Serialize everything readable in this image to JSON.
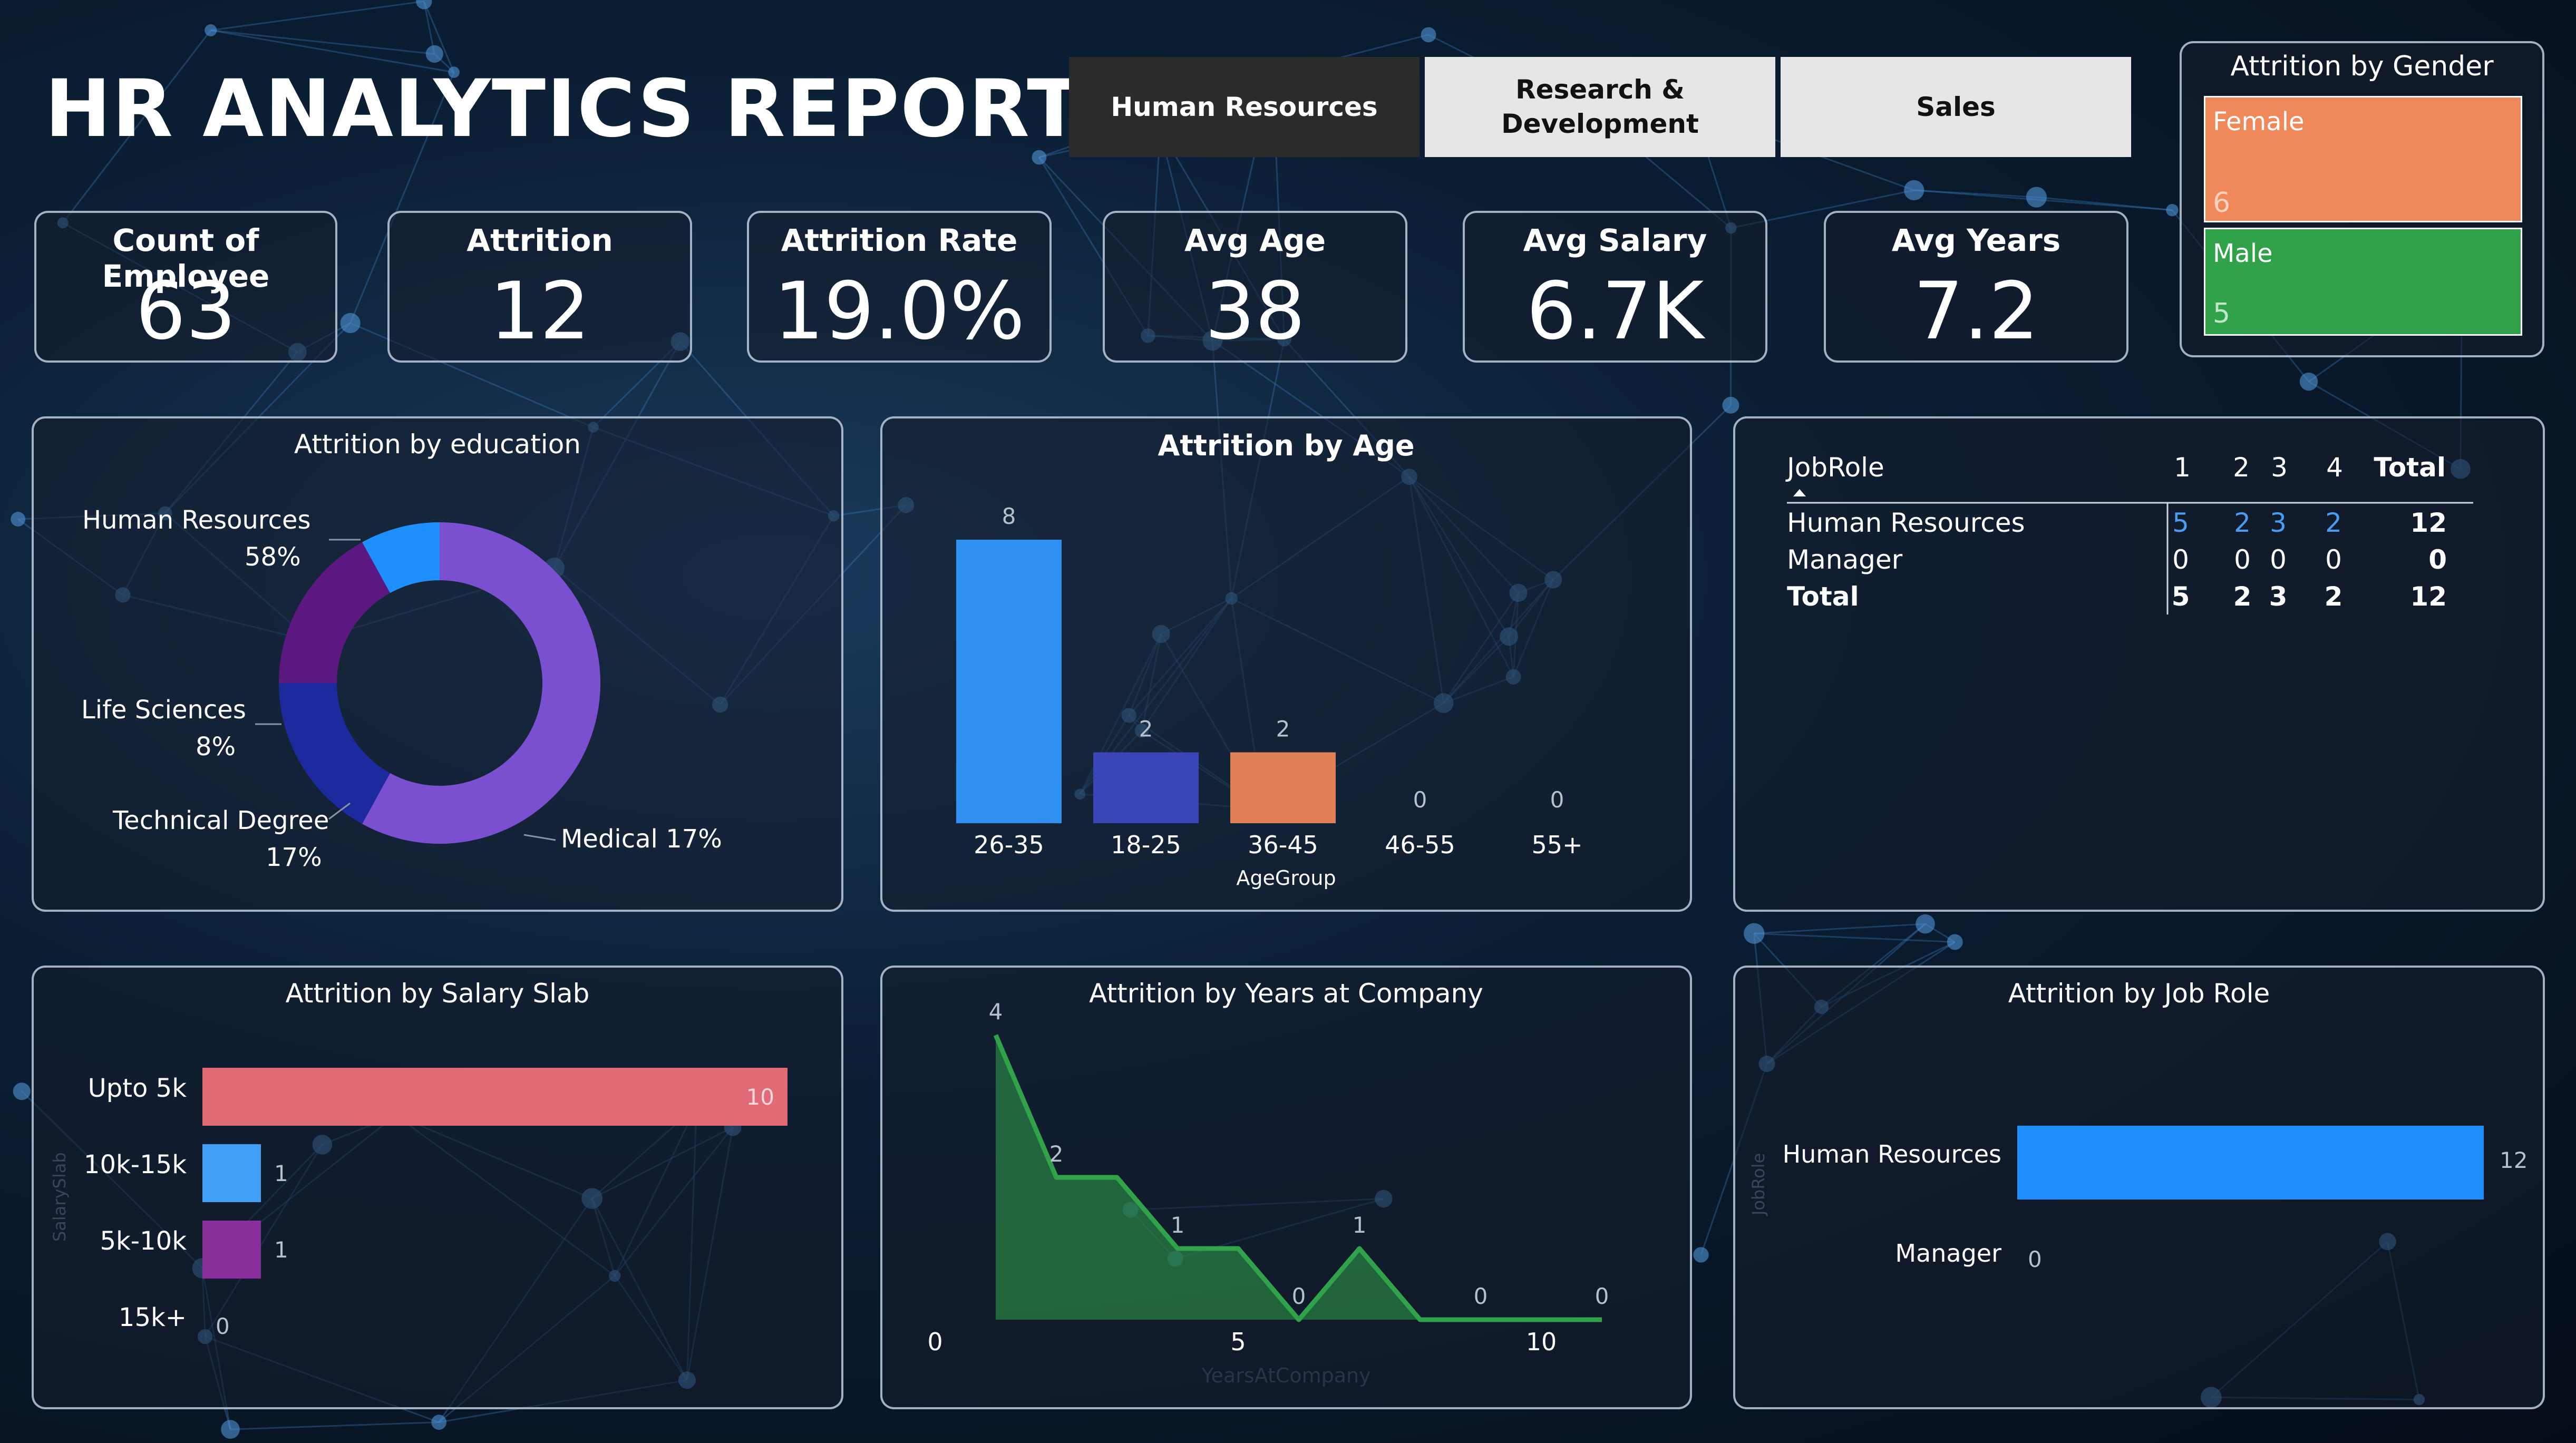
{
  "title": "HR ANALYTICS REPORT",
  "tabs": [
    {
      "label": "Human Resources",
      "active": true
    },
    {
      "label": "Research & Development",
      "active": false
    },
    {
      "label": "Sales",
      "active": false
    }
  ],
  "kpis": [
    {
      "label": "Count of Employee",
      "value": "63"
    },
    {
      "label": "Attrition",
      "value": "12"
    },
    {
      "label": "Attrition Rate",
      "value": "19.0%"
    },
    {
      "label": "Avg Age",
      "value": "38"
    },
    {
      "label": "Avg Salary",
      "value": "6.7K"
    },
    {
      "label": "Avg Years",
      "value": "7.2"
    }
  ],
  "gender": {
    "title": "Attrition by Gender",
    "items": [
      {
        "label": "Female",
        "value": "6",
        "color": "#f0895a"
      },
      {
        "label": "Male",
        "value": "5",
        "color": "#2fa24a"
      }
    ]
  },
  "education": {
    "title": "Attrition by education",
    "slices": [
      {
        "label": "Human Resources",
        "pct": "58%",
        "value": 58,
        "color": "#7a4fd0"
      },
      {
        "label": "Medical",
        "pct": "17%",
        "value": 17,
        "color": "#1d2a9e"
      },
      {
        "label": "Technical Degree",
        "pct": "17%",
        "value": 17,
        "color": "#5a1880"
      },
      {
        "label": "Life Sciences",
        "pct": "8%",
        "value": 8,
        "color": "#1e8fff"
      }
    ]
  },
  "age": {
    "title": "Attrition by Age",
    "xlabel": "AgeGroup",
    "categories": [
      "26-35",
      "18-25",
      "36-45",
      "46-55",
      "55+"
    ],
    "values": [
      8,
      2,
      2,
      0,
      0
    ],
    "colors": [
      "#2e90f0",
      "#3a46b8",
      "#e08057",
      "#2e90f0",
      "#2e90f0"
    ]
  },
  "matrix": {
    "header": [
      "JobRole",
      "1",
      "2",
      "3",
      "4",
      "Total"
    ],
    "rows": [
      {
        "cells": [
          "Human Resources",
          "5",
          "2",
          "3",
          "2",
          "12"
        ]
      },
      {
        "cells": [
          "Manager",
          "0",
          "0",
          "0",
          "0",
          "0"
        ]
      },
      {
        "cells": [
          "Total",
          "5",
          "2",
          "3",
          "2",
          "12"
        ]
      }
    ]
  },
  "salary": {
    "title": "Attrition by Salary Slab",
    "categories": [
      "Upto 5k",
      "10k-15k",
      "5k-10k",
      "15k+"
    ],
    "values": [
      10,
      1,
      1,
      0
    ],
    "colors": [
      "#e06b74",
      "#3f9ff5",
      "#8a2e9c",
      "#3f9ff5"
    ],
    "ylabel": "SalarySlab"
  },
  "years": {
    "title": "Attrition by Years at Company",
    "xlabel": "YearsAtCompany",
    "x_ticks": [
      "0",
      "5",
      "10"
    ],
    "x": [
      1,
      2,
      3,
      4,
      5,
      6,
      7,
      8,
      9,
      10
    ],
    "values": [
      4,
      2,
      2,
      1,
      1,
      0,
      1,
      0,
      0,
      0
    ],
    "labels": [
      {
        "x": 1,
        "text": "4"
      },
      {
        "x": 2,
        "text": "2"
      },
      {
        "x": 4,
        "text": "1"
      },
      {
        "x": 6,
        "text": "0"
      },
      {
        "x": 7,
        "text": "1"
      },
      {
        "x": 9,
        "text": "0"
      },
      {
        "x": 11,
        "text": "0"
      }
    ],
    "color": "#2fa24a"
  },
  "jobrole": {
    "title": "Attrition by Job Role",
    "categories": [
      "Human Resources",
      "Manager"
    ],
    "values": [
      12,
      0
    ],
    "color": "#1e8fff",
    "ylabel": "JobRole"
  }
}
